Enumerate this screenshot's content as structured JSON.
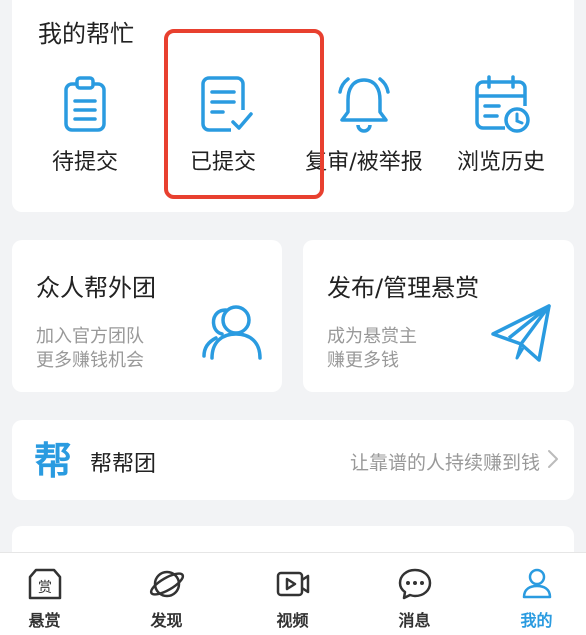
{
  "my_help": {
    "title": "我的帮忙",
    "items": [
      {
        "label": "待提交",
        "icon": "clipboard-icon"
      },
      {
        "label": "已提交",
        "icon": "document-check-icon"
      },
      {
        "label": "复审/被举报",
        "icon": "bell-icon"
      },
      {
        "label": "浏览历史",
        "icon": "calendar-clock-icon"
      }
    ]
  },
  "team_card": {
    "title": "众人帮外团",
    "sub1": "加入官方团队",
    "sub2": "更多赚钱机会",
    "icon": "people-icon"
  },
  "publish_card": {
    "title": "发布/管理悬赏",
    "sub1": "成为悬赏主",
    "sub2": "赚更多钱",
    "icon": "paper-plane-icon"
  },
  "bbt": {
    "logo_text": "帮",
    "label": "帮帮团",
    "slogan": "让靠谱的人持续赚到钱"
  },
  "tabbar": {
    "tabs": [
      {
        "label": "悬赏",
        "icon": "reward-icon"
      },
      {
        "label": "发现",
        "icon": "planet-icon"
      },
      {
        "label": "视频",
        "icon": "video-icon"
      },
      {
        "label": "消息",
        "icon": "message-icon"
      },
      {
        "label": "我的",
        "icon": "user-icon",
        "active": true
      }
    ]
  },
  "colors": {
    "accent": "#2a9be0",
    "highlight": "#e8402f",
    "muted_text": "#999999"
  }
}
